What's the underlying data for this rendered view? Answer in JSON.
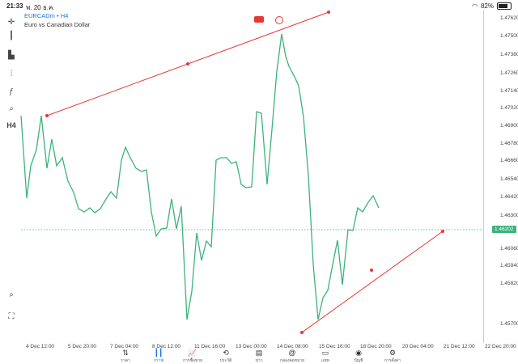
{
  "status_bar": {
    "time": "21:33",
    "date": "พ. 20 ธ.ค.",
    "wifi_icon": "wifi-icon",
    "battery": "82%",
    "battery_level": 0.82
  },
  "symbol": {
    "name": "EURCADm • H4",
    "description": "Euro vs Canadian Dollar"
  },
  "toolbar": [
    {
      "name": "crosshair-icon",
      "glyph": "✛"
    },
    {
      "name": "candles-icon",
      "glyph": "┃"
    },
    {
      "name": "indicators-icon",
      "glyph": "▙"
    },
    {
      "name": "objects-icon",
      "glyph": "⫶"
    },
    {
      "name": "function-icon",
      "glyph": "ƒ"
    },
    {
      "name": "shapes-icon",
      "glyph": "⌕"
    },
    {
      "name": "timeframe-button",
      "glyph": "H4"
    }
  ],
  "price_axis": [
    "1.47620",
    "1.47500",
    "1.47380",
    "1.47260",
    "1.47140",
    "1.47020",
    "1.46900",
    "1.46780",
    "1.46660",
    "1.46540",
    "1.46420",
    "1.46300",
    "1.46060",
    "1.45940",
    "1.45820",
    "1.45700"
  ],
  "current_price": "1.46202",
  "time_axis": [
    "4 Dec 12:00",
    "5 Dec 20:00",
    "7 Dec 04:00",
    "8 Dec 12:00",
    "11 Dec 16:00",
    "13 Dec 00:00",
    "14 Dec 08:00",
    "15 Dec 16:00",
    "18 Dec 20:00",
    "20 Dec 04:00",
    "21 Dec 12:00",
    "22 Dec 20:00"
  ],
  "colors": {
    "line": "#3cb37a",
    "trend": "#e53935",
    "accent": "#1a73e8"
  },
  "bottom_nav": [
    {
      "name": "nav-quotes",
      "icon": "quotes-icon",
      "glyph": "⇅",
      "label": "ราคา"
    },
    {
      "name": "nav-chart",
      "icon": "chart-icon",
      "glyph": "┃┃",
      "label": "กราฟ",
      "active": true
    },
    {
      "name": "nav-trade",
      "icon": "trade-icon",
      "glyph": "📈",
      "label": "การซื้อขาย"
    },
    {
      "name": "nav-history",
      "icon": "history-icon",
      "glyph": "⟲",
      "label": "ประวัติ"
    },
    {
      "name": "nav-news",
      "icon": "news-icon",
      "glyph": "▤",
      "label": "ข่าว"
    },
    {
      "name": "nav-mailbox",
      "icon": "at-icon",
      "glyph": "@",
      "label": "กล่องจดหมาย"
    },
    {
      "name": "nav-chat",
      "icon": "chat-icon",
      "glyph": "▭",
      "label": "แชท"
    },
    {
      "name": "nav-account",
      "icon": "account-icon",
      "glyph": "◉",
      "label": "บัญชี"
    },
    {
      "name": "nav-settings",
      "icon": "settings-icon",
      "glyph": "⚙",
      "label": "การตั้งค่า"
    }
  ]
}
